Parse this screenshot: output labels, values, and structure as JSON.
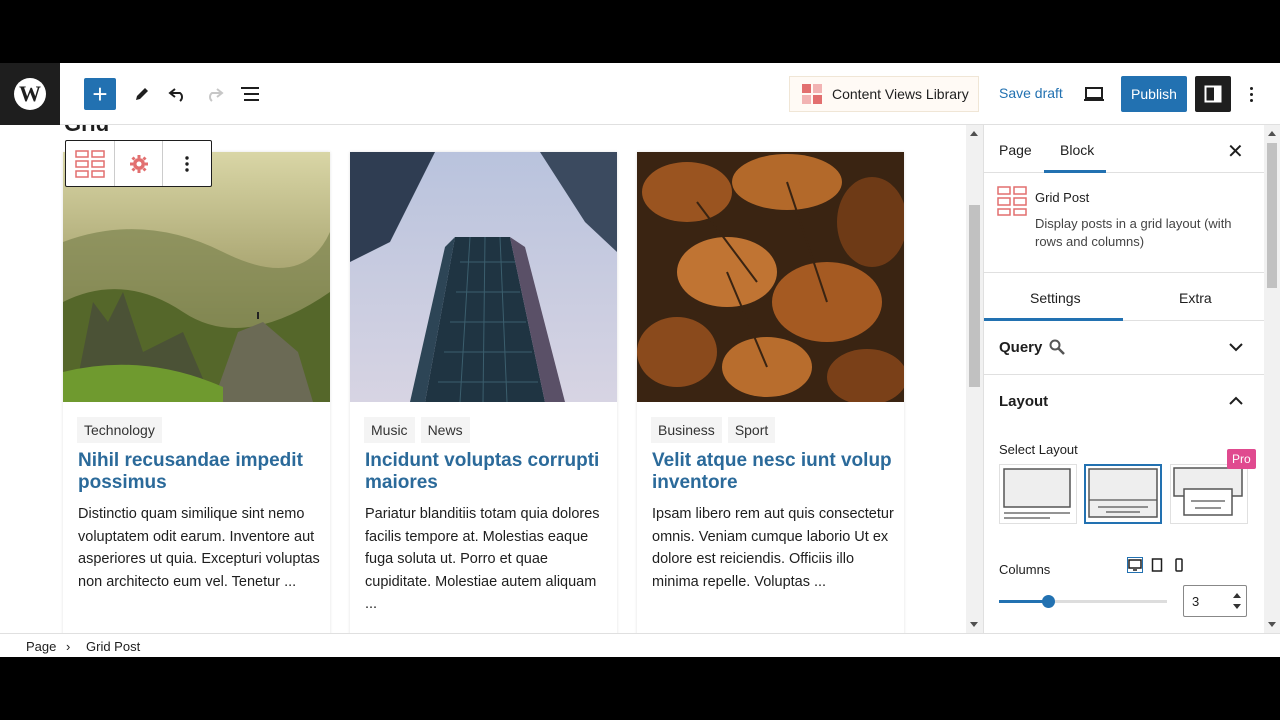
{
  "toolbar": {
    "content_views_library": "Content Views Library",
    "save_draft": "Save draft",
    "publish": "Publish"
  },
  "canvas": {
    "partial_title": "Grid",
    "posts": [
      {
        "categories": [
          "Technology"
        ],
        "title": "Nihil recusandae impedit possimus",
        "excerpt": "Distinctio quam similique sint nemo voluptatem odit earum. Inventore aut asperiores ut quia. Excepturi voluptas non architecto eum vel. Tenetur ...",
        "image": "mountain-landscape"
      },
      {
        "categories": [
          "Music",
          "News"
        ],
        "title": "Incidunt voluptas corrupti maiores",
        "excerpt": "Pariatur blanditiis totam quia dolores facilis tempore at. Molestias eaque fuga soluta ut. Porro et quae cupiditate. Molestiae autem aliquam ...",
        "image": "skyscrapers"
      },
      {
        "categories": [
          "Business",
          "Sport"
        ],
        "title": "Velit atque nesc iunt volup inventore",
        "excerpt": "Ipsam libero rem aut quis consectetur omnis. Veniam cumque laborio Ut ex dolore est reiciendis. Officiis illo minima repelle. Voluptas ...",
        "image": "autumn-leaves"
      }
    ]
  },
  "sidebar": {
    "tabs": {
      "page": "Page",
      "block": "Block"
    },
    "block": {
      "name": "Grid Post",
      "description": "Display posts in a grid layout (with rows and columns)"
    },
    "settings_tabs": {
      "settings": "Settings",
      "extra": "Extra"
    },
    "panels": {
      "query": "Query",
      "layout": "Layout"
    },
    "select_layout": "Select Layout",
    "pro_badge": "Pro",
    "columns": {
      "label": "Columns",
      "value": "3"
    }
  },
  "breadcrumb": {
    "root": "Page",
    "current": "Grid Post"
  },
  "colors": {
    "accent": "#2271b1",
    "title_link": "#2b6a9a",
    "pro": "#e04a8f",
    "brand_icon": "#e26f6f"
  }
}
